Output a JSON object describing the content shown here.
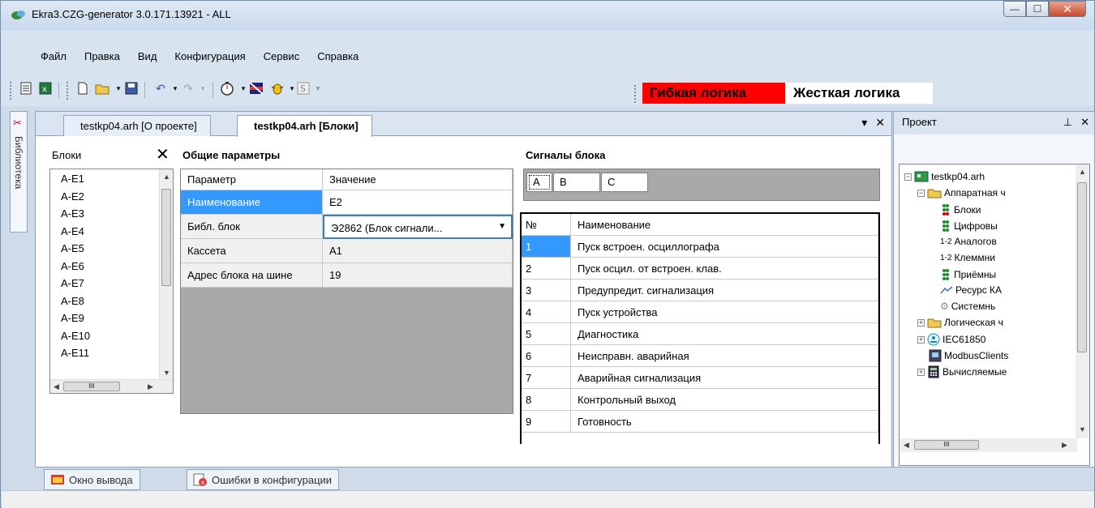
{
  "window": {
    "title": "Ekra3.CZG-generator 3.0.171.13921 - ALL",
    "controls": {
      "minimize": "—",
      "maximize": "☐",
      "close": "✕"
    }
  },
  "menu": [
    "Файл",
    "Правка",
    "Вид",
    "Конфигурация",
    "Сервис",
    "Справка"
  ],
  "toolbar": {
    "logic_flexible": "Гибкая логика",
    "logic_rigid": "Жесткая логика"
  },
  "side_tab": {
    "label": "Библиотека"
  },
  "doc_tabs": [
    {
      "label": "testkp04.arh [О проекте]",
      "active": false
    },
    {
      "label": "testkp04.arh [Блоки]",
      "active": true
    }
  ],
  "doc_controls": {
    "dropdown": "▾",
    "close": "✕"
  },
  "blocks": {
    "title": "Блоки",
    "close": "✕",
    "items": [
      "A-E1",
      "A-E2",
      "A-E3",
      "A-E4",
      "A-E5",
      "A-E6",
      "A-E7",
      "A-E8",
      "A-E9",
      "A-E10",
      "A-E11"
    ],
    "hscroll_grip": "III"
  },
  "params": {
    "title": "Общие параметры",
    "header": {
      "param": "Параметр",
      "value": "Значение"
    },
    "rows": [
      {
        "param": "Наименование",
        "value": "E2"
      },
      {
        "param": "Библ. блок",
        "value": "Э2862 (Блок сигнали..."
      },
      {
        "param": "Кассета",
        "value": "A1"
      },
      {
        "param": "Адрес блока на шине",
        "value": "19"
      }
    ]
  },
  "signals": {
    "title": "Сигналы блока",
    "tabs": [
      "A",
      "B",
      "C"
    ],
    "header": {
      "num": "№",
      "name": "Наименование"
    },
    "rows": [
      {
        "num": "1",
        "name": "Пуск встроен. осциллографа"
      },
      {
        "num": "2",
        "name": "Пуск осцил. от встроен. клав."
      },
      {
        "num": "3",
        "name": "Предупредит. сигнализация"
      },
      {
        "num": "4",
        "name": "Пуск устройства"
      },
      {
        "num": "5",
        "name": "Диагностика"
      },
      {
        "num": "6",
        "name": "Неисправн. аварийная"
      },
      {
        "num": "7",
        "name": "Аварийная сигнализация"
      },
      {
        "num": "8",
        "name": "Контрольный выход"
      },
      {
        "num": "9",
        "name": "Готовность"
      }
    ]
  },
  "project": {
    "title": "Проект",
    "pin": "⊥",
    "close": "✕",
    "tree": {
      "root": "testkp04.arh",
      "hardware": "Аппаратная ч",
      "blocks": "Блоки",
      "digital": "Цифровы",
      "analog": "Аналогов",
      "terminal": "Клеммни",
      "receivers": "Приёмны",
      "resource": "Ресурс КА",
      "system": "Системнь",
      "logical": "Логическая ч",
      "iec": "IEC61850",
      "modbus": "ModbusClients",
      "computed": "Вычисляемые"
    },
    "hscroll_grip": "III"
  },
  "bottom_tabs": [
    "Окно вывода",
    "Ошибки в конфигурации"
  ],
  "colors": {
    "selection": "#3399ff",
    "logic_active": "#ff0000"
  }
}
